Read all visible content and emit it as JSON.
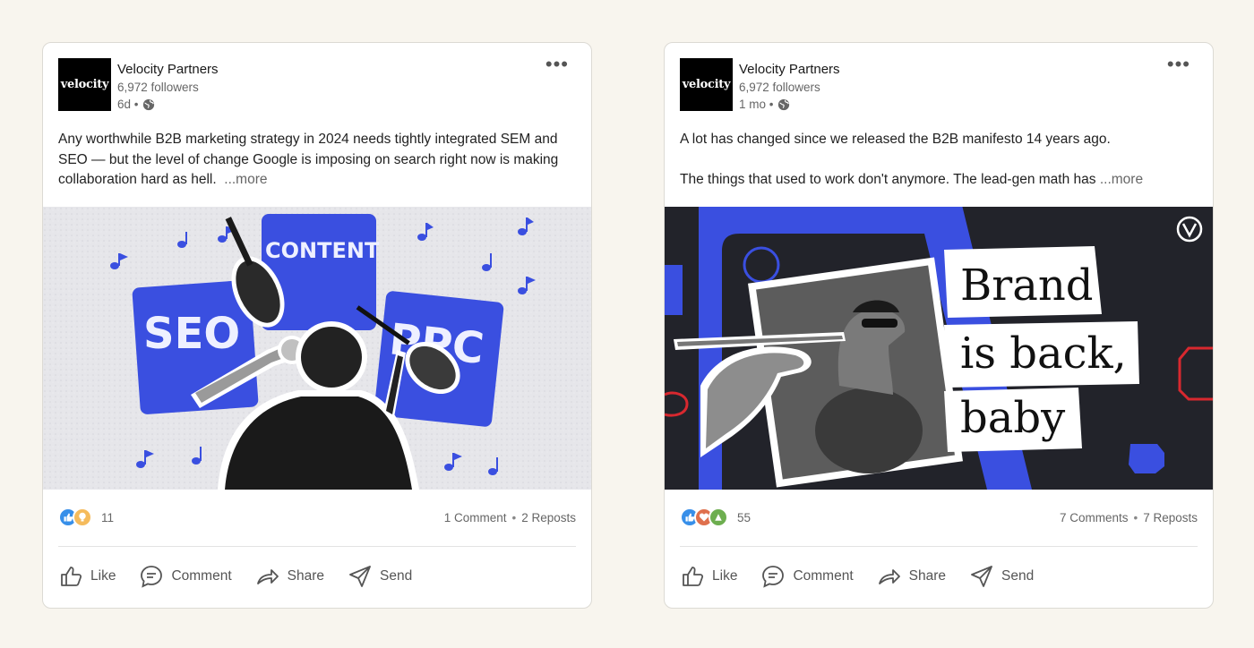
{
  "posts": [
    {
      "company": "Velocity Partners",
      "logo_text": "velocity",
      "followers": "6,972 followers",
      "age": "6d •",
      "body": [
        "Any worthwhile B2B marketing strategy in 2024 needs tightly integrated SEM and SEO — but the level of change Google is imposing on search right now is making collaboration hard as hell."
      ],
      "more": "...more",
      "image": {
        "labels": [
          "SEO",
          "CONTENT",
          "PPC"
        ]
      },
      "reaction_count": "11",
      "comments": "1 Comment",
      "reposts": "2 Reposts"
    },
    {
      "company": "Velocity Partners",
      "logo_text": "velocity",
      "followers": "6,972 followers",
      "age": "1 mo •",
      "body": [
        "A lot has changed since we released the B2B manifesto 14 years ago.",
        "The things that used to work don't anymore. The lead-gen math has"
      ],
      "more": "...more",
      "image": {
        "lines": [
          "Brand",
          "is back,",
          "baby"
        ]
      },
      "reaction_count": "55",
      "comments": "7 Comments",
      "reposts": "7 Reposts"
    }
  ],
  "actions": {
    "like": "Like",
    "comment": "Comment",
    "share": "Share",
    "send": "Send"
  },
  "separator": "•"
}
